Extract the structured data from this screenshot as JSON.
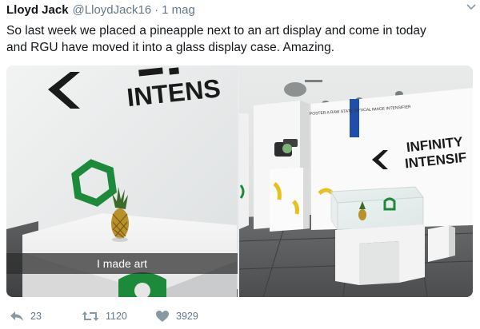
{
  "tweet": {
    "author_name": "Lloyd Jack",
    "author_handle": "@LloydJack16",
    "separator": "·",
    "timestamp": "1 mag",
    "text_line1": "So last week we placed a pineapple next to an art display and come in today",
    "text_line2": "and RGU have moved it into a glass display case. Amazing.",
    "caret_icon": "chevron-down-icon"
  },
  "media": {
    "left_photo": {
      "wall_text": "INTENS",
      "snap_caption": "I made art"
    },
    "right_photo": {
      "wall_text_line1": "INFINITY",
      "wall_text_line2": "INTENSIF",
      "small_text": "POSTER A RAW STATE OPTICAL IMAGE INTENSIFIER"
    }
  },
  "actions": {
    "reply_count": "23",
    "retweet_count": "1120",
    "like_count": "3929",
    "reply_icon": "reply-icon",
    "retweet_icon": "retweet-icon",
    "like_icon": "heart-icon"
  },
  "colors": {
    "text": "#14171a",
    "muted": "#657786",
    "hexagon_green": "#1c8a3a",
    "pineapple_yellow": "#c9a227"
  }
}
